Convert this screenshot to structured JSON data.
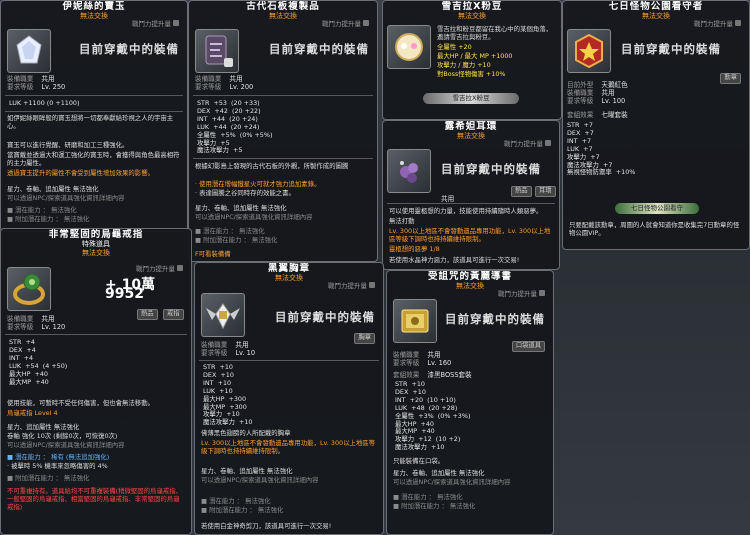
{
  "common": {
    "tradeable": "無法交換",
    "power": "戰鬥力提升量",
    "wearing": "目前穿戴中的裝備",
    "job_label": "裝備職業",
    "level_label": "要求等級",
    "job_all": "共用"
  },
  "p1": {
    "title": "伊妮絲的寶玉",
    "job": "共用",
    "level": "Lv. 250",
    "stats": "LUK +1100 (0 +1100)",
    "desc1": "如伊妮絲眼眸般的寶玉想將一切都奉獻給珍視之人的宇宙主心。",
    "desc2": "寶玉可以進行覺醒、研磨和加工三種強化。",
    "desc3": "當寶戴並透過大和運工強化的寶玉時，會獲得與角色最高相符的主力屬性。",
    "desc4": "透過寶玉提升的屬性不會受到屬性增加效果的影響。",
    "star": "星力、卷軸、追加屬性 無法強化",
    "nopot": "可以透過NPC/探索道具強化資訊詳細內容",
    "pot1": "■ 潛在能力 ： 無法強化",
    "pot2": "■ 附加潛在能力 ： 無法強化"
  },
  "p2": {
    "title": "古代石板複製品",
    "job": "共用",
    "level": "Lv. 200",
    "stats": "STR  +53  (20 +33)\nDEX  +42  (20 +22)\nINT  +44  (20 +24)\nLUK  +44  (20 +24)\n全屬性  +5%  (0% +5%)\n攻擊力  +5\n魔法攻擊力  +5",
    "desc1": "根據幻影島上發現的古代石板的外觀，所製作成的圖騰",
    "desc2": "· 使用潛在增幅鐵星火可就才強力追加素錄。",
    "desc3": "· 表達圖騰之谷同時存的效能之書。",
    "star": "星力、卷軸、追加屬性 無法強化",
    "nopot": "可以透過NPC/探索道具強化資訊詳細內容",
    "pot1": "■ 潛在能力 ： 無法強化",
    "pot2": "■ 附加潛在能力 ： 無法強化",
    "hint": "F可看裝備備"
  },
  "p3": {
    "title": "雪吉拉X粉豆",
    "l1": "雪吉拉和粉豆都留在我心中的某個角落，邀請雪吉拉與粉豆。",
    "l2": "全屬性 +20",
    "l3": "最大HP / 最大 MP +1000",
    "l4": "攻擊力 / 魔力 +10",
    "l5": "對Boss怪物傷害 +10%",
    "banner": "雪吉拉X粉豆"
  },
  "p4": {
    "title": "七日怪物公園看守者",
    "type_label": "目前外型",
    "type": "天鵝紅色",
    "level": "Lv. 100",
    "stat_title": "套組效果",
    "set": "七曜套裝",
    "stats": "STR  +7\nDEX  +7\nINT  +7\nLUK  +7\n攻擊力  +7\n魔法攻擊力  +7\n無視怪物防禦率  +10%",
    "banner": "七日怪物公園看守",
    "desc": "只要配戴該勳章，周圍的人就會知道你是收集完7日勳章的怪物公園VIP。",
    "button": "勳章"
  },
  "p5": {
    "title": "露希妲耳環",
    "btn1": "熱品",
    "btn2": "耳環",
    "job": "共用",
    "desc1": "可以使用靈柩想的力量，技能使用持續隨時人類惡夢。",
    "desc2": "無法打動",
    "desc3": "Lv. 300以上地區不會發動遺品專用功能，Lv. 300以上地區等級下調時也持持續維持限制。",
    "desc4": "靈柩想的惡夢 1/8",
    "desc5": "若使用水晶神力惡力，該道具可進行一次交易!"
  },
  "p6": {
    "title": "非常堅固的烏龜戒指",
    "sub": "特殊道具",
    "level": "Lv. 120",
    "amount": "+ 10萬 9952",
    "btn1": "熱品",
    "btn2": "戒指",
    "stats": "STR  +4\nDEX  +4\nINT  +4\nLUK  +54  (4 +50)\n最大HP  +40\n最大MP  +40",
    "desc1": "使用技能，可暫時不受任何傷害，但也會無法移動。",
    "desc2": "烏龜戒指 Level 4",
    "desc3": "星力、追加屬性 無法強化",
    "desc4": "卷軸 強化 10次 (剩餘0次，可恢復0次)",
    "desc5": "可以透過NPC/探索道具強化資訊詳細內容",
    "pot1": "■ 潛在能力 ： 稀有 (無法追加強化)",
    "pot1b": "· 被擊時 5% 機率來忽略傷害的 4%",
    "pot2": "■ 附加潛在能力 ： 無法強化",
    "warn1": "不可重複持有。道具給均不可重複裝備(稍微堅固的烏龜戒指、一般堅固的烏龜戒指、相當堅固的烏龜戒指、非常堅固的烏龜戒指)"
  },
  "p7": {
    "title": "黑翼胸章",
    "btn": "胸章",
    "level": "Lv. 10",
    "stats": "STR  +10\nDEX  +10\nINT  +10\nLUK  +10\n最大HP  +300\n最大MP  +300\n攻擊力  +10\n魔法攻擊力  +10",
    "desc1": "佛薄黑色翅膀的人所配戴的胸章",
    "desc2": "Lv. 300以上地區不會發動遺品專用功能，Lv. 300以上地區等級下調時也持持續維持限制。",
    "star": "星力、卷軸、追加屬性 無法強化",
    "nopot": "可以透過NPC/探索道具強化資訊詳細內容",
    "pot1": "■ 潛在能力 ： 無法強化",
    "pot2": "■ 附加潛在能力 ： 無法強化",
    "trade": "若使用白金神奇剪刀，該道具可進行一次交易!"
  },
  "p8": {
    "title": "受詛咒的黃麗導書",
    "btn": "口袋道具",
    "level": "Lv. 160",
    "set_label": "套組效果",
    "set": "漆黑BOSS套裝",
    "stats": "STR  +10\nDEX  +10\nINT  +20  (10 +10)\nLUK  +48  (20 +28)\n全屬性  +3%  (0% +3%)\n最大HP  +40\n最大MP  +40\n攻擊力  +12  (10 +2)\n魔法攻擊力  +10",
    "desc1": "只能裝備在口袋。",
    "star": "星力、卷軸、追加屬性 無法強化",
    "nopot": "可以透過NPC/探索道具強化資訊詳細內容",
    "pot1": "■ 潛在能力 ： 無法強化",
    "pot2": "■ 附加潛在能力 ： 無法強化"
  }
}
